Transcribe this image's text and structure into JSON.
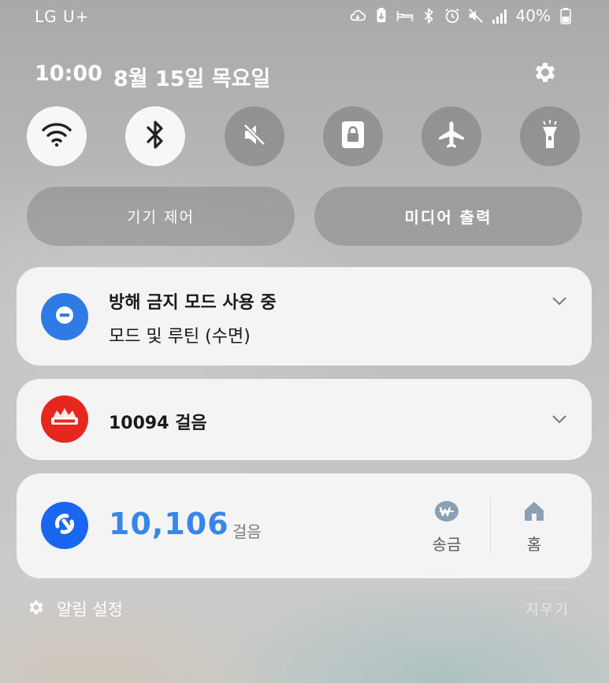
{
  "status_bar": {
    "carrier": "LG U+",
    "battery_percent": "40%",
    "icons": [
      "cloud-sync-icon",
      "battery-saver-icon",
      "bed-icon",
      "bluetooth-icon",
      "alarm-icon",
      "mute-icon",
      "signal-icon",
      "battery-icon"
    ]
  },
  "header": {
    "time": "10:00",
    "date": "8월 15일 목요일"
  },
  "quick_toggles": [
    {
      "icon": "wifi-icon",
      "state": "on"
    },
    {
      "icon": "bluetooth-icon",
      "state": "on"
    },
    {
      "icon": "sound-mute-icon",
      "state": "off"
    },
    {
      "icon": "screen-lock-icon",
      "state": "off"
    },
    {
      "icon": "airplane-icon",
      "state": "off"
    },
    {
      "icon": "flashlight-icon",
      "state": "off"
    }
  ],
  "controls": {
    "device_control": "기기 제어",
    "media_output": "미디어 출력"
  },
  "notifications": {
    "dnd": {
      "title": "방해 금지 모드 사용 중",
      "subtitle": "모드 및 루틴 (수면)"
    },
    "steps": {
      "title": "10094 걸음",
      "app_icon": "cashwalk-logo-icon"
    }
  },
  "widget": {
    "count": "10,106",
    "unit": "걸음",
    "send_label": "송금",
    "home_label": "홈"
  },
  "footer": {
    "notification_settings": "알림 설정",
    "clear": "지우기"
  },
  "colors": {
    "accent_blue": "#3a86e8",
    "dnd_blue": "#2f7be6",
    "steps_red": "#e5271e",
    "widget_blue": "#1967f0"
  }
}
